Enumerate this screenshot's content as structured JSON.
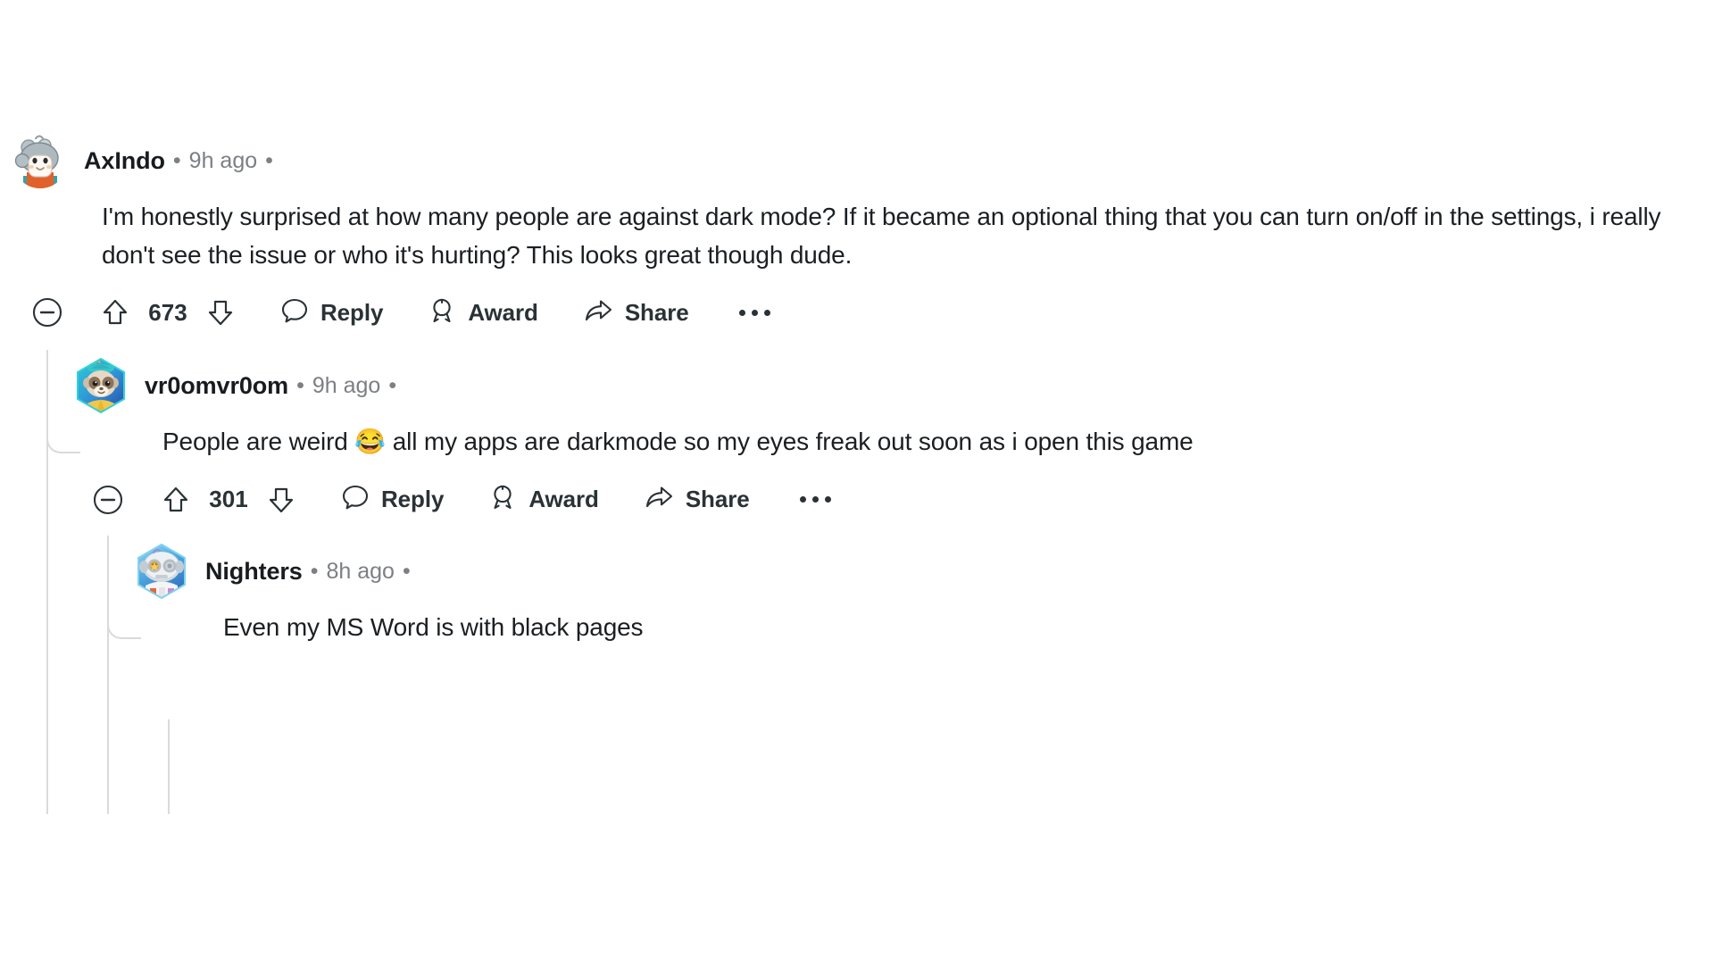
{
  "theme": {
    "background": "#ffffff",
    "body_text": "#1b1f22",
    "username_text": "#181c1f",
    "meta_text": "#7c7f83",
    "action_text": "#2a3236",
    "thread_line": "#d9dadb"
  },
  "comments": [
    {
      "id": "comment-axlndo",
      "depth": 0,
      "author": "AxIndo",
      "timestamp": "9h ago",
      "separator": "•",
      "avatar_name": "avatar-axlndo",
      "body": "I'm honestly surprised at how many people are against dark mode? If it became an optional thing that you can turn on/off in the settings, i really don't see the issue or who it's hurting? This looks great though dude.",
      "score": "673",
      "actions": {
        "collapse_label": "Collapse thread",
        "upvote_label": "Upvote",
        "downvote_label": "Downvote",
        "reply_label": "Reply",
        "award_label": "Award",
        "share_label": "Share",
        "more_label": "More options"
      }
    },
    {
      "id": "comment-vr0omvr0om",
      "depth": 1,
      "author": "vr0omvr0om",
      "timestamp": "9h ago",
      "separator": "•",
      "avatar_name": "avatar-vr0omvr0om",
      "body_before_emoji": "People are weird ",
      "emoji": "😂",
      "emoji_name": "face-with-tears-of-joy-emoji",
      "body_after_emoji": " all my apps are darkmode so my eyes freak out soon as i open this game",
      "score": "301",
      "actions": {
        "collapse_label": "Collapse thread",
        "upvote_label": "Upvote",
        "downvote_label": "Downvote",
        "reply_label": "Reply",
        "award_label": "Award",
        "share_label": "Share",
        "more_label": "More options"
      }
    },
    {
      "id": "comment-nighters",
      "depth": 2,
      "author": "Nighters",
      "timestamp": "8h ago",
      "separator": "•",
      "avatar_name": "avatar-nighters",
      "body": "Even my MS Word is with black pages"
    }
  ]
}
